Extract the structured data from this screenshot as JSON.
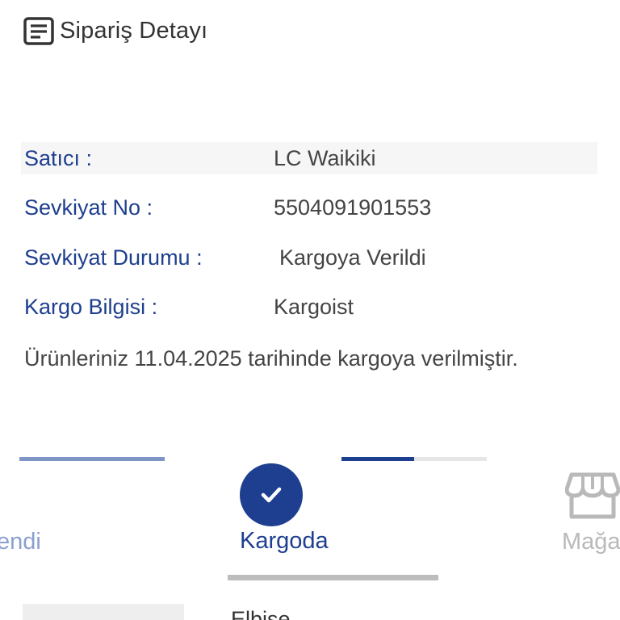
{
  "header": {
    "title": "Sipariş Detayı",
    "icon": "document-list-icon"
  },
  "details": {
    "seller_label": "Satıcı :",
    "seller_value": "LC Waikiki",
    "shipment_no_label": "Sevkiyat No :",
    "shipment_no_value": "5504091901553",
    "shipment_status_label": "Sevkiyat Durumu :",
    "shipment_status_value": "Kargoya Verildi",
    "cargo_label": "Kargo Bilgisi :",
    "cargo_value": "Kargoist"
  },
  "message": "Ürünleriniz 11.04.2025 tarihinde kargoya verilmiştir.",
  "steps": {
    "left_label": "endi",
    "active_label": "Kargoda",
    "right_label": "Mağa",
    "active_icon": "check-icon",
    "right_icon": "store-icon"
  },
  "product": {
    "name": "Elbise"
  },
  "colors": {
    "primary": "#1e3f8f",
    "light_primary": "#8aa0cf",
    "muted": "#b9b9b9"
  }
}
